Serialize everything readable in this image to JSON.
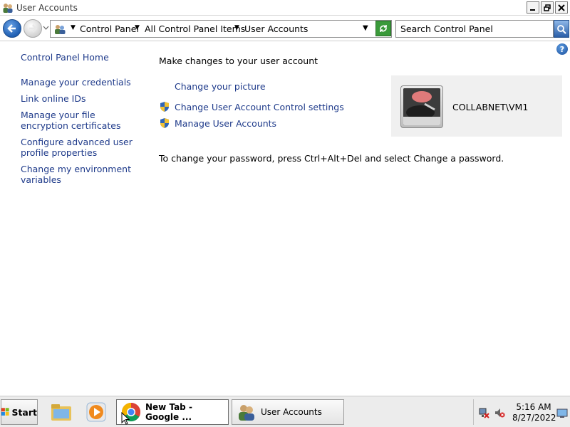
{
  "window": {
    "title": "User Accounts"
  },
  "address_bar": {
    "crumbs": [
      "Control Panel",
      "All Control Panel Items",
      "User Accounts"
    ]
  },
  "search": {
    "placeholder": "Search Control Panel"
  },
  "left_nav": {
    "items": [
      "Control Panel Home",
      "Manage your credentials",
      "Link online IDs",
      "Manage your file encryption certificates",
      "Configure advanced user profile properties",
      "Change my environment variables"
    ]
  },
  "main": {
    "heading": "Make changes to your user account",
    "tasks": [
      "Change your picture",
      "Change User Account Control settings",
      "Manage User Accounts"
    ],
    "password_note": "To change your password, press Ctrl+Alt+Del and select Change a password.",
    "user_name": "COLLABNET\\VM1"
  },
  "taskbar": {
    "start_label": "Start",
    "tasks": [
      {
        "label": "New Tab - Google ...",
        "icon": "chrome-icon",
        "active": true
      },
      {
        "label": "User Accounts",
        "icon": "user-accounts-icon",
        "active": false
      }
    ],
    "clock_time": "5:16 AM",
    "clock_date": "8/27/2022"
  },
  "colors": {
    "link": "#1e3a8a",
    "userbox_bg": "#f0f0f0",
    "taskbar_bg": "#ececec"
  }
}
